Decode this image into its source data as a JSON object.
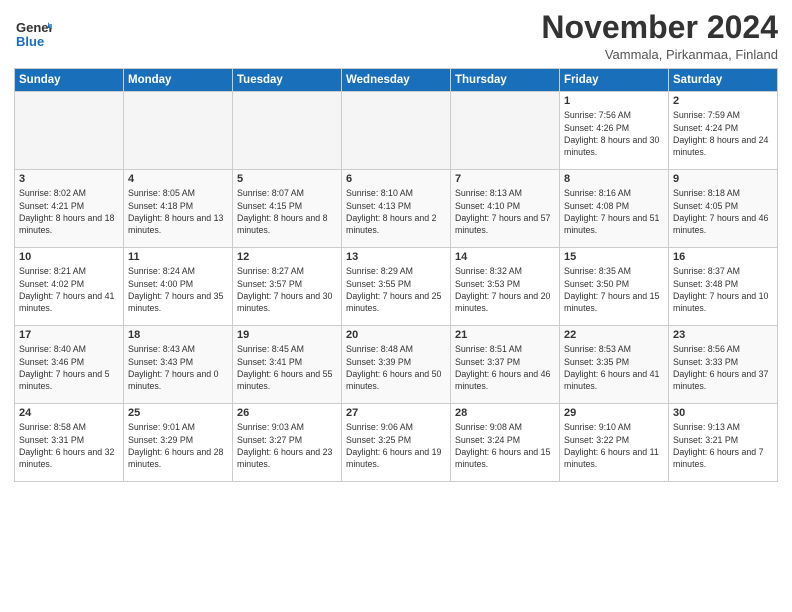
{
  "logo": {
    "line1": "General",
    "line2": "Blue"
  },
  "title": "November 2024",
  "location": "Vammala, Pirkanmaa, Finland",
  "weekdays": [
    "Sunday",
    "Monday",
    "Tuesday",
    "Wednesday",
    "Thursday",
    "Friday",
    "Saturday"
  ],
  "weeks": [
    [
      {
        "day": "",
        "info": ""
      },
      {
        "day": "",
        "info": ""
      },
      {
        "day": "",
        "info": ""
      },
      {
        "day": "",
        "info": ""
      },
      {
        "day": "",
        "info": ""
      },
      {
        "day": "1",
        "info": "Sunrise: 7:56 AM\nSunset: 4:26 PM\nDaylight: 8 hours and 30 minutes."
      },
      {
        "day": "2",
        "info": "Sunrise: 7:59 AM\nSunset: 4:24 PM\nDaylight: 8 hours and 24 minutes."
      }
    ],
    [
      {
        "day": "3",
        "info": "Sunrise: 8:02 AM\nSunset: 4:21 PM\nDaylight: 8 hours and 18 minutes."
      },
      {
        "day": "4",
        "info": "Sunrise: 8:05 AM\nSunset: 4:18 PM\nDaylight: 8 hours and 13 minutes."
      },
      {
        "day": "5",
        "info": "Sunrise: 8:07 AM\nSunset: 4:15 PM\nDaylight: 8 hours and 8 minutes."
      },
      {
        "day": "6",
        "info": "Sunrise: 8:10 AM\nSunset: 4:13 PM\nDaylight: 8 hours and 2 minutes."
      },
      {
        "day": "7",
        "info": "Sunrise: 8:13 AM\nSunset: 4:10 PM\nDaylight: 7 hours and 57 minutes."
      },
      {
        "day": "8",
        "info": "Sunrise: 8:16 AM\nSunset: 4:08 PM\nDaylight: 7 hours and 51 minutes."
      },
      {
        "day": "9",
        "info": "Sunrise: 8:18 AM\nSunset: 4:05 PM\nDaylight: 7 hours and 46 minutes."
      }
    ],
    [
      {
        "day": "10",
        "info": "Sunrise: 8:21 AM\nSunset: 4:02 PM\nDaylight: 7 hours and 41 minutes."
      },
      {
        "day": "11",
        "info": "Sunrise: 8:24 AM\nSunset: 4:00 PM\nDaylight: 7 hours and 35 minutes."
      },
      {
        "day": "12",
        "info": "Sunrise: 8:27 AM\nSunset: 3:57 PM\nDaylight: 7 hours and 30 minutes."
      },
      {
        "day": "13",
        "info": "Sunrise: 8:29 AM\nSunset: 3:55 PM\nDaylight: 7 hours and 25 minutes."
      },
      {
        "day": "14",
        "info": "Sunrise: 8:32 AM\nSunset: 3:53 PM\nDaylight: 7 hours and 20 minutes."
      },
      {
        "day": "15",
        "info": "Sunrise: 8:35 AM\nSunset: 3:50 PM\nDaylight: 7 hours and 15 minutes."
      },
      {
        "day": "16",
        "info": "Sunrise: 8:37 AM\nSunset: 3:48 PM\nDaylight: 7 hours and 10 minutes."
      }
    ],
    [
      {
        "day": "17",
        "info": "Sunrise: 8:40 AM\nSunset: 3:46 PM\nDaylight: 7 hours and 5 minutes."
      },
      {
        "day": "18",
        "info": "Sunrise: 8:43 AM\nSunset: 3:43 PM\nDaylight: 7 hours and 0 minutes."
      },
      {
        "day": "19",
        "info": "Sunrise: 8:45 AM\nSunset: 3:41 PM\nDaylight: 6 hours and 55 minutes."
      },
      {
        "day": "20",
        "info": "Sunrise: 8:48 AM\nSunset: 3:39 PM\nDaylight: 6 hours and 50 minutes."
      },
      {
        "day": "21",
        "info": "Sunrise: 8:51 AM\nSunset: 3:37 PM\nDaylight: 6 hours and 46 minutes."
      },
      {
        "day": "22",
        "info": "Sunrise: 8:53 AM\nSunset: 3:35 PM\nDaylight: 6 hours and 41 minutes."
      },
      {
        "day": "23",
        "info": "Sunrise: 8:56 AM\nSunset: 3:33 PM\nDaylight: 6 hours and 37 minutes."
      }
    ],
    [
      {
        "day": "24",
        "info": "Sunrise: 8:58 AM\nSunset: 3:31 PM\nDaylight: 6 hours and 32 minutes."
      },
      {
        "day": "25",
        "info": "Sunrise: 9:01 AM\nSunset: 3:29 PM\nDaylight: 6 hours and 28 minutes."
      },
      {
        "day": "26",
        "info": "Sunrise: 9:03 AM\nSunset: 3:27 PM\nDaylight: 6 hours and 23 minutes."
      },
      {
        "day": "27",
        "info": "Sunrise: 9:06 AM\nSunset: 3:25 PM\nDaylight: 6 hours and 19 minutes."
      },
      {
        "day": "28",
        "info": "Sunrise: 9:08 AM\nSunset: 3:24 PM\nDaylight: 6 hours and 15 minutes."
      },
      {
        "day": "29",
        "info": "Sunrise: 9:10 AM\nSunset: 3:22 PM\nDaylight: 6 hours and 11 minutes."
      },
      {
        "day": "30",
        "info": "Sunrise: 9:13 AM\nSunset: 3:21 PM\nDaylight: 6 hours and 7 minutes."
      }
    ]
  ]
}
